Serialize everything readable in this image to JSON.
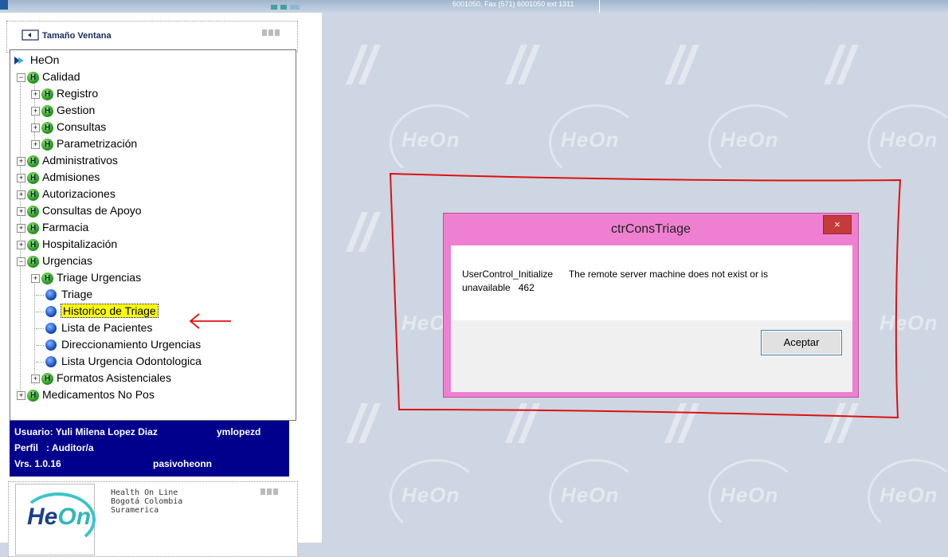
{
  "topbar": {
    "contact_text": "6001050, Fax (571) 6001050 ext 1311"
  },
  "window_size_bar": {
    "label": "Tamaño Ventana"
  },
  "tree": {
    "root": "HeOn",
    "calidad": "Calidad",
    "registro": "Registro",
    "gestion": "Gestion",
    "consultas": "Consultas",
    "parametrizacion": "Parametrización",
    "administrativos": "Administrativos",
    "admisiones": "Admisiones",
    "autorizaciones": "Autorizaciones",
    "consultas_apoyo": "Consultas de Apoyo",
    "farmacia": "Farmacia",
    "hospitalizacion": "Hospitalización",
    "urgencias": "Urgencias",
    "triage_urgencias": "Triage Urgencias",
    "triage": "Triage",
    "historico_triage": "Historico de Triage",
    "lista_pacientes": "Lista de Pacientes",
    "direccionamiento": "Direccionamiento Urgencias",
    "lista_odontologica": "Lista Urgencia Odontologica",
    "formatos": "Formatos Asistenciales",
    "medicamentos": "Medicamentos No Pos"
  },
  "user_info": {
    "usuario_label": "Usuario: Yuli Milena Lopez Diaz",
    "username": "ymlopezd",
    "perfil_label": "Perfil   : Auditor/a",
    "version": "Vrs. 1.0.16",
    "server": "pasivoheonn"
  },
  "logo": {
    "brand_a": "He",
    "brand_b": "On",
    "info": "Health On Line\nBogotá Colombia\nSuramerica"
  },
  "watermark": {
    "text": "HeOn"
  },
  "dialog": {
    "title": "ctrConsTriage",
    "close": "×",
    "message_line1": "UserControl_Initialize      The remote server machine does not exist or is",
    "message_line2": "unavailable   462",
    "ok_button": "Aceptar"
  },
  "colors": {
    "dialog_frame": "#ef7fd0",
    "user_box": "#00008c",
    "annotation": "#e01010",
    "selection": "#ffff00"
  }
}
